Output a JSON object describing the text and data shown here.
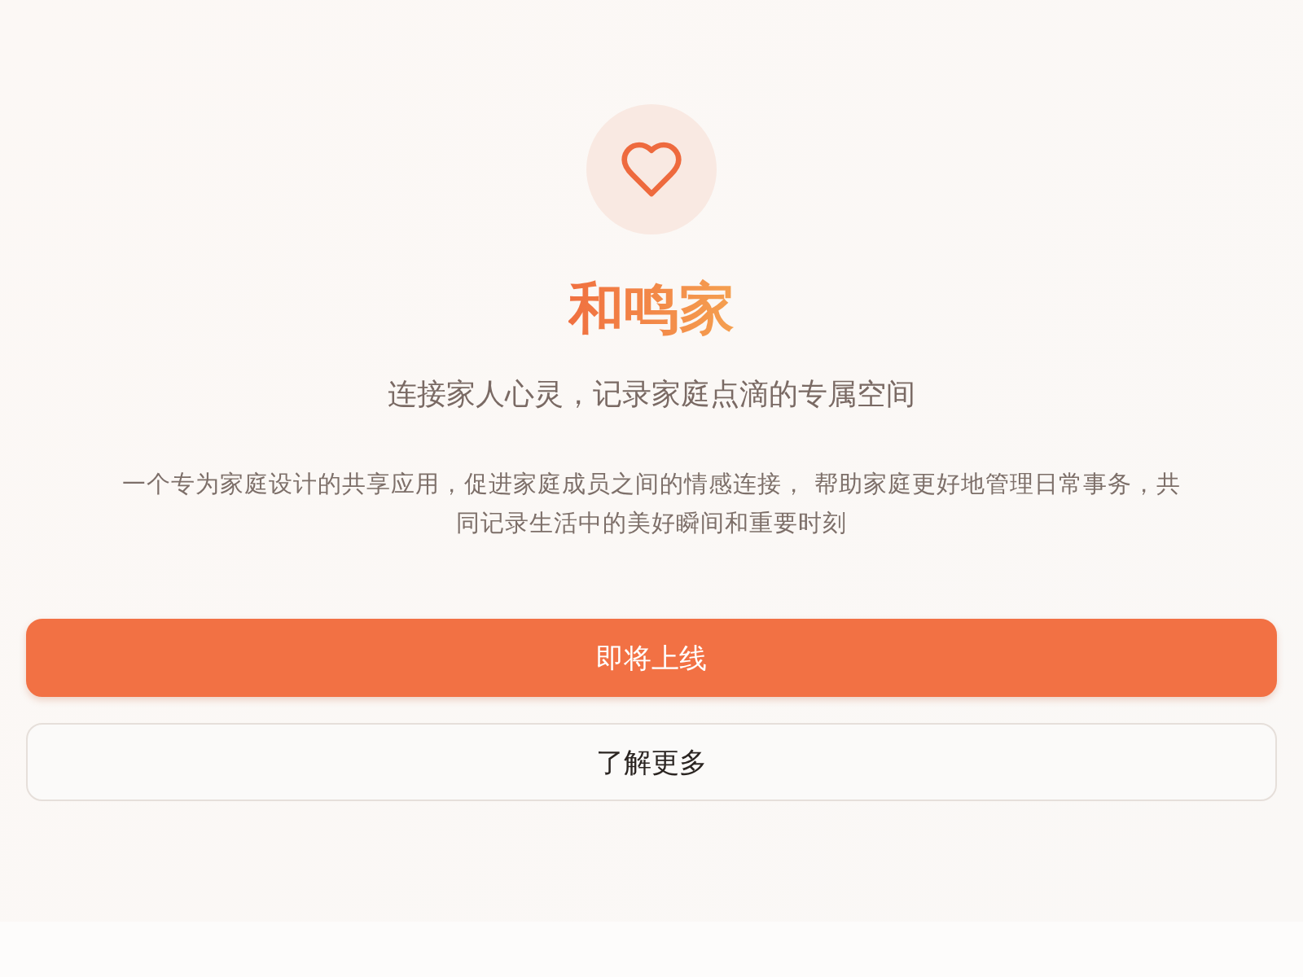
{
  "app": {
    "name": "和鸣家",
    "tagline": "连接家人心灵，记录家庭点滴的专属空间",
    "description": "一个专为家庭设计的共享应用，促进家庭成员之间的情感连接， 帮助家庭更好地管理日常事务，共同记录生活中的美好瞬间和重要时刻"
  },
  "buttons": [
    {
      "label": "即将上线",
      "kind": "primary"
    },
    {
      "label": "了解更多",
      "kind": "secondary"
    }
  ]
}
